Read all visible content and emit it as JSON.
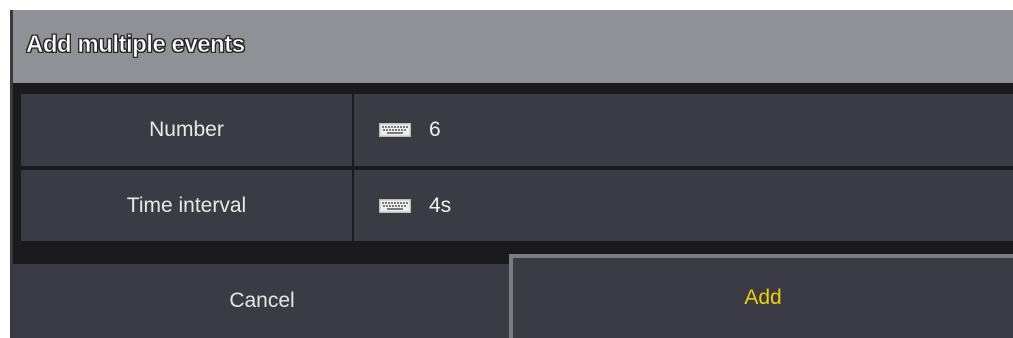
{
  "dialog": {
    "title": "Add multiple events"
  },
  "fields": [
    {
      "label": "Number",
      "value": "6",
      "icon": "keyboard-icon"
    },
    {
      "label": "Time interval",
      "value": "4s",
      "icon": "keyboard-icon"
    }
  ],
  "buttons": {
    "cancel_label": "Cancel",
    "add_label": "Add"
  },
  "colors": {
    "titlebar": "#8f9196",
    "cell": "#3b3b44",
    "background": "#1b1b1f",
    "accent_text": "#f0d000"
  }
}
